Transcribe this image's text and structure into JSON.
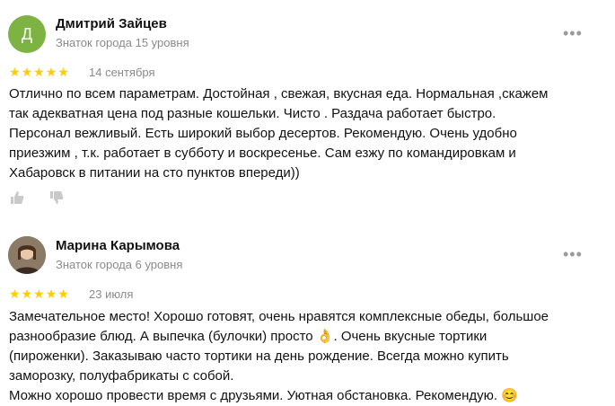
{
  "reviews": [
    {
      "avatar_letter": "Д",
      "name": "Дмитрий Зайцев",
      "level": "Знаток города 15 уровня",
      "rating": 5,
      "date": "14 сентября",
      "text": "Отлично по всем параметрам. Достойная , свежая, вкусная еда. Нормальная ,скажем\nтак адекватная цена под разные кошельки. Чисто . Раздача работает быстро.\nПерсонал вежливый. Есть широкий выбор десертов. Рекомендую. Очень удобно\nприезжим , т.к. работает в субботу и воскресенье. Сам езжу по командировкам и\nХабаровск в питании на сто пунктов впереди))"
    },
    {
      "name": "Марина Карымова",
      "level": "Знаток города 6 уровня",
      "rating": 5,
      "date": "23 июля",
      "text": "Замечательное место! Хорошо готовят, очень нравятся комплексные обеды, большое\nразнообразие блюд. А выпечка (булочки) просто 👌. Очень вкусные тортики\n(пироженки). Заказываю часто тортики на день рождение. Всегда можно купить\nзаморозку, полуфабрикаты с собой.\nМожно хорошо провести время с друзьями. Уютная обстановка. Рекомендую. 😊"
    }
  ],
  "more_label": "•••",
  "star_glyph": "★",
  "colors": {
    "star": "#ffcc00",
    "avatar_green": "#7cb342",
    "muted": "#8a8a8a"
  }
}
